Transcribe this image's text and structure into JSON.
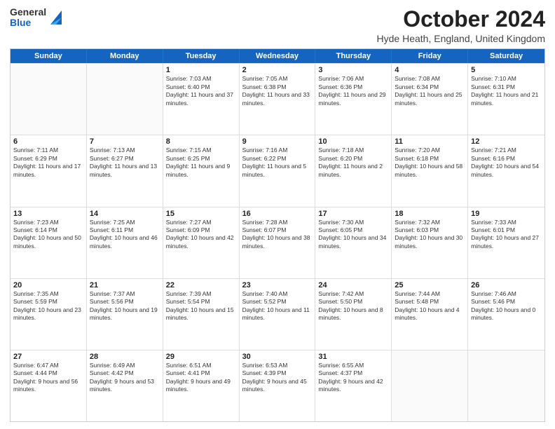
{
  "logo": {
    "general": "General",
    "blue": "Blue"
  },
  "header": {
    "month": "October 2024",
    "location": "Hyde Heath, England, United Kingdom"
  },
  "days": [
    "Sunday",
    "Monday",
    "Tuesday",
    "Wednesday",
    "Thursday",
    "Friday",
    "Saturday"
  ],
  "weeks": [
    [
      {
        "day": "",
        "empty": true
      },
      {
        "day": "",
        "empty": true
      },
      {
        "day": "1",
        "sunrise": "Sunrise: 7:03 AM",
        "sunset": "Sunset: 6:40 PM",
        "daylight": "Daylight: 11 hours and 37 minutes."
      },
      {
        "day": "2",
        "sunrise": "Sunrise: 7:05 AM",
        "sunset": "Sunset: 6:38 PM",
        "daylight": "Daylight: 11 hours and 33 minutes."
      },
      {
        "day": "3",
        "sunrise": "Sunrise: 7:06 AM",
        "sunset": "Sunset: 6:36 PM",
        "daylight": "Daylight: 11 hours and 29 minutes."
      },
      {
        "day": "4",
        "sunrise": "Sunrise: 7:08 AM",
        "sunset": "Sunset: 6:34 PM",
        "daylight": "Daylight: 11 hours and 25 minutes."
      },
      {
        "day": "5",
        "sunrise": "Sunrise: 7:10 AM",
        "sunset": "Sunset: 6:31 PM",
        "daylight": "Daylight: 11 hours and 21 minutes."
      }
    ],
    [
      {
        "day": "6",
        "sunrise": "Sunrise: 7:11 AM",
        "sunset": "Sunset: 6:29 PM",
        "daylight": "Daylight: 11 hours and 17 minutes."
      },
      {
        "day": "7",
        "sunrise": "Sunrise: 7:13 AM",
        "sunset": "Sunset: 6:27 PM",
        "daylight": "Daylight: 11 hours and 13 minutes."
      },
      {
        "day": "8",
        "sunrise": "Sunrise: 7:15 AM",
        "sunset": "Sunset: 6:25 PM",
        "daylight": "Daylight: 11 hours and 9 minutes."
      },
      {
        "day": "9",
        "sunrise": "Sunrise: 7:16 AM",
        "sunset": "Sunset: 6:22 PM",
        "daylight": "Daylight: 11 hours and 5 minutes."
      },
      {
        "day": "10",
        "sunrise": "Sunrise: 7:18 AM",
        "sunset": "Sunset: 6:20 PM",
        "daylight": "Daylight: 11 hours and 2 minutes."
      },
      {
        "day": "11",
        "sunrise": "Sunrise: 7:20 AM",
        "sunset": "Sunset: 6:18 PM",
        "daylight": "Daylight: 10 hours and 58 minutes."
      },
      {
        "day": "12",
        "sunrise": "Sunrise: 7:21 AM",
        "sunset": "Sunset: 6:16 PM",
        "daylight": "Daylight: 10 hours and 54 minutes."
      }
    ],
    [
      {
        "day": "13",
        "sunrise": "Sunrise: 7:23 AM",
        "sunset": "Sunset: 6:14 PM",
        "daylight": "Daylight: 10 hours and 50 minutes."
      },
      {
        "day": "14",
        "sunrise": "Sunrise: 7:25 AM",
        "sunset": "Sunset: 6:11 PM",
        "daylight": "Daylight: 10 hours and 46 minutes."
      },
      {
        "day": "15",
        "sunrise": "Sunrise: 7:27 AM",
        "sunset": "Sunset: 6:09 PM",
        "daylight": "Daylight: 10 hours and 42 minutes."
      },
      {
        "day": "16",
        "sunrise": "Sunrise: 7:28 AM",
        "sunset": "Sunset: 6:07 PM",
        "daylight": "Daylight: 10 hours and 38 minutes."
      },
      {
        "day": "17",
        "sunrise": "Sunrise: 7:30 AM",
        "sunset": "Sunset: 6:05 PM",
        "daylight": "Daylight: 10 hours and 34 minutes."
      },
      {
        "day": "18",
        "sunrise": "Sunrise: 7:32 AM",
        "sunset": "Sunset: 6:03 PM",
        "daylight": "Daylight: 10 hours and 30 minutes."
      },
      {
        "day": "19",
        "sunrise": "Sunrise: 7:33 AM",
        "sunset": "Sunset: 6:01 PM",
        "daylight": "Daylight: 10 hours and 27 minutes."
      }
    ],
    [
      {
        "day": "20",
        "sunrise": "Sunrise: 7:35 AM",
        "sunset": "Sunset: 5:59 PM",
        "daylight": "Daylight: 10 hours and 23 minutes."
      },
      {
        "day": "21",
        "sunrise": "Sunrise: 7:37 AM",
        "sunset": "Sunset: 5:56 PM",
        "daylight": "Daylight: 10 hours and 19 minutes."
      },
      {
        "day": "22",
        "sunrise": "Sunrise: 7:39 AM",
        "sunset": "Sunset: 5:54 PM",
        "daylight": "Daylight: 10 hours and 15 minutes."
      },
      {
        "day": "23",
        "sunrise": "Sunrise: 7:40 AM",
        "sunset": "Sunset: 5:52 PM",
        "daylight": "Daylight: 10 hours and 11 minutes."
      },
      {
        "day": "24",
        "sunrise": "Sunrise: 7:42 AM",
        "sunset": "Sunset: 5:50 PM",
        "daylight": "Daylight: 10 hours and 8 minutes."
      },
      {
        "day": "25",
        "sunrise": "Sunrise: 7:44 AM",
        "sunset": "Sunset: 5:48 PM",
        "daylight": "Daylight: 10 hours and 4 minutes."
      },
      {
        "day": "26",
        "sunrise": "Sunrise: 7:46 AM",
        "sunset": "Sunset: 5:46 PM",
        "daylight": "Daylight: 10 hours and 0 minutes."
      }
    ],
    [
      {
        "day": "27",
        "sunrise": "Sunrise: 6:47 AM",
        "sunset": "Sunset: 4:44 PM",
        "daylight": "Daylight: 9 hours and 56 minutes."
      },
      {
        "day": "28",
        "sunrise": "Sunrise: 6:49 AM",
        "sunset": "Sunset: 4:42 PM",
        "daylight": "Daylight: 9 hours and 53 minutes."
      },
      {
        "day": "29",
        "sunrise": "Sunrise: 6:51 AM",
        "sunset": "Sunset: 4:41 PM",
        "daylight": "Daylight: 9 hours and 49 minutes."
      },
      {
        "day": "30",
        "sunrise": "Sunrise: 6:53 AM",
        "sunset": "Sunset: 4:39 PM",
        "daylight": "Daylight: 9 hours and 45 minutes."
      },
      {
        "day": "31",
        "sunrise": "Sunrise: 6:55 AM",
        "sunset": "Sunset: 4:37 PM",
        "daylight": "Daylight: 9 hours and 42 minutes."
      },
      {
        "day": "",
        "empty": true
      },
      {
        "day": "",
        "empty": true
      }
    ]
  ]
}
